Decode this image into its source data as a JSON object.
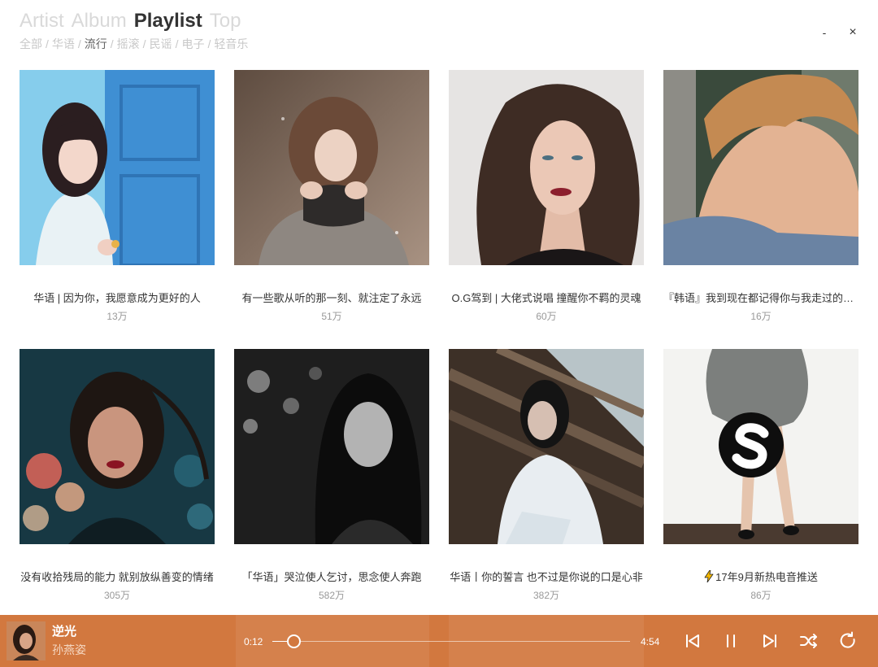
{
  "window": {
    "minimize": "-",
    "close": "×"
  },
  "nav": {
    "tabs": [
      "Artist",
      "Album",
      "Playlist",
      "Top"
    ],
    "active_tab": "Playlist",
    "categories": [
      "全部",
      "华语",
      "流行",
      "摇滚",
      "民谣",
      "电子",
      "轻音乐"
    ],
    "active_category": "流行",
    "separator": "/"
  },
  "playlists": [
    {
      "title": "华语 | 因为你，我愿意成为更好的人",
      "plays": "13万"
    },
    {
      "title": "有一些歌从听的那一刻、就注定了永远",
      "plays": "51万"
    },
    {
      "title": "O.G驾到 | 大佬式说唱 撞醒你不羁的灵魂",
      "plays": "60万"
    },
    {
      "title": "『韩语』我到现在都记得你与我走过的那...",
      "plays": "16万"
    },
    {
      "title": "没有收拾残局的能力 就别放纵善变的情绪",
      "plays": "305万"
    },
    {
      "title": "「华语」哭泣使人乞讨，思念使人奔跑",
      "plays": "582万"
    },
    {
      "title": "华语丨你的誓言 也不过是你说的口是心非",
      "plays": "382万"
    },
    {
      "title": "17年9月新热电音推送",
      "plays": "86万",
      "icon": "lightning-icon"
    }
  ],
  "player": {
    "title": "逆光",
    "artist": "孙燕姿",
    "elapsed": "0:12",
    "duration": "4:54",
    "progress": 0.06,
    "controls": [
      "skip-back-icon",
      "pause-icon",
      "skip-forward-icon",
      "shuffle-icon",
      "repeat-icon"
    ]
  },
  "colors": {
    "player_bar": "#d2783f",
    "tab_active": "#333333",
    "tab_inactive": "#d9d9d9",
    "category_active": "#666666",
    "category_inactive": "#c8c8c8",
    "title_text": "#333333",
    "count_text": "#999999",
    "artist_text": "#f5d8c3"
  }
}
